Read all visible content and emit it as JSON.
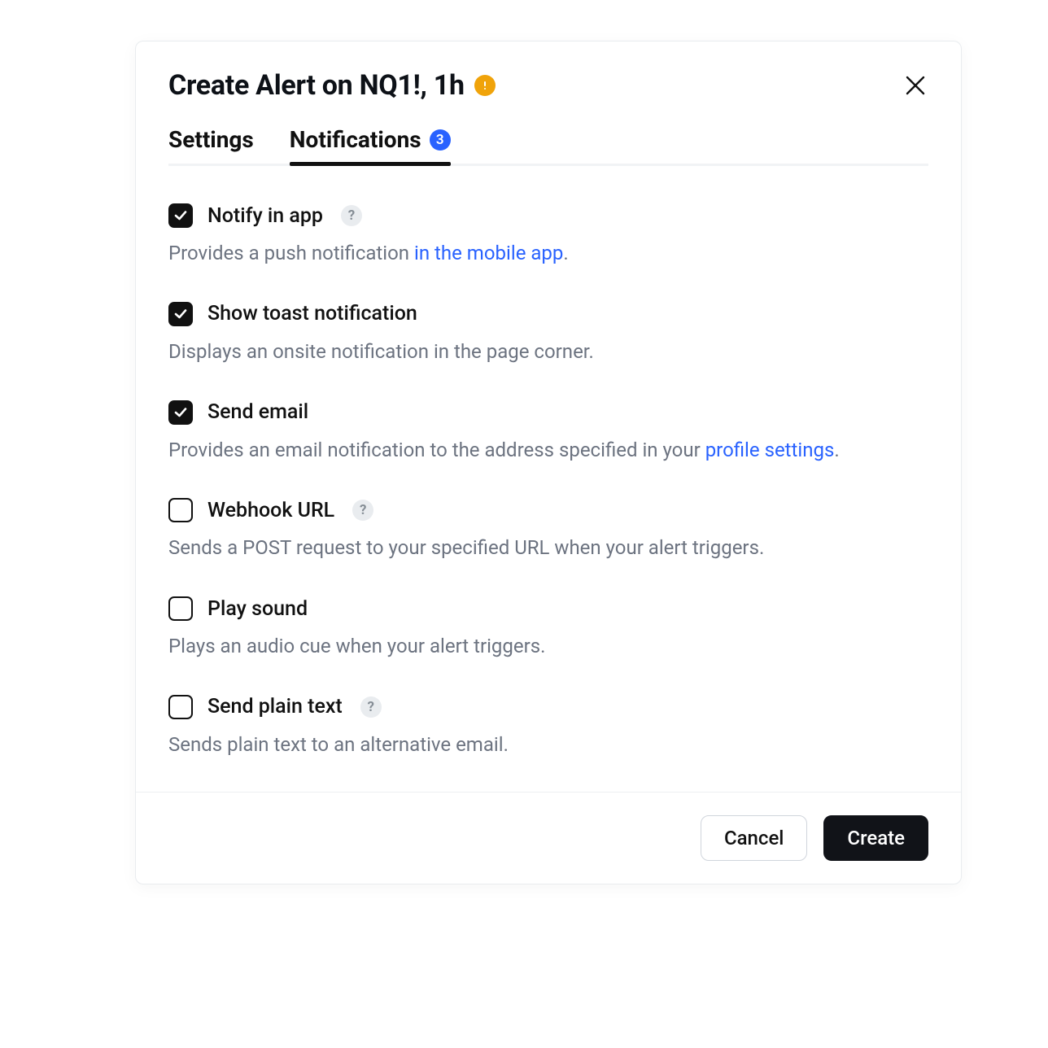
{
  "dialog": {
    "title": "Create Alert on NQ1!, 1h"
  },
  "tabs": {
    "settings": "Settings",
    "notifications": "Notifications",
    "badge": "3"
  },
  "options": [
    {
      "label": "Notify in app",
      "checked": true,
      "help": true,
      "desc_pre": "Provides a push notification ",
      "link": "in the mobile app",
      "desc_post": "."
    },
    {
      "label": "Show toast notification",
      "checked": true,
      "help": false,
      "desc_pre": "Displays an onsite notification in the page corner.",
      "link": "",
      "desc_post": ""
    },
    {
      "label": "Send email",
      "checked": true,
      "help": false,
      "desc_pre": "Provides an email notification to the address specified in your ",
      "link": "profile settings",
      "desc_post": "."
    },
    {
      "label": "Webhook URL",
      "checked": false,
      "help": true,
      "desc_pre": "Sends a POST request to your specified URL when your alert triggers.",
      "link": "",
      "desc_post": ""
    },
    {
      "label": "Play sound",
      "checked": false,
      "help": false,
      "desc_pre": "Plays an audio cue when your alert triggers.",
      "link": "",
      "desc_post": ""
    },
    {
      "label": "Send plain text",
      "checked": false,
      "help": true,
      "desc_pre": "Sends plain text to an alternative email.",
      "link": "",
      "desc_post": ""
    }
  ],
  "footer": {
    "cancel": "Cancel",
    "create": "Create"
  }
}
